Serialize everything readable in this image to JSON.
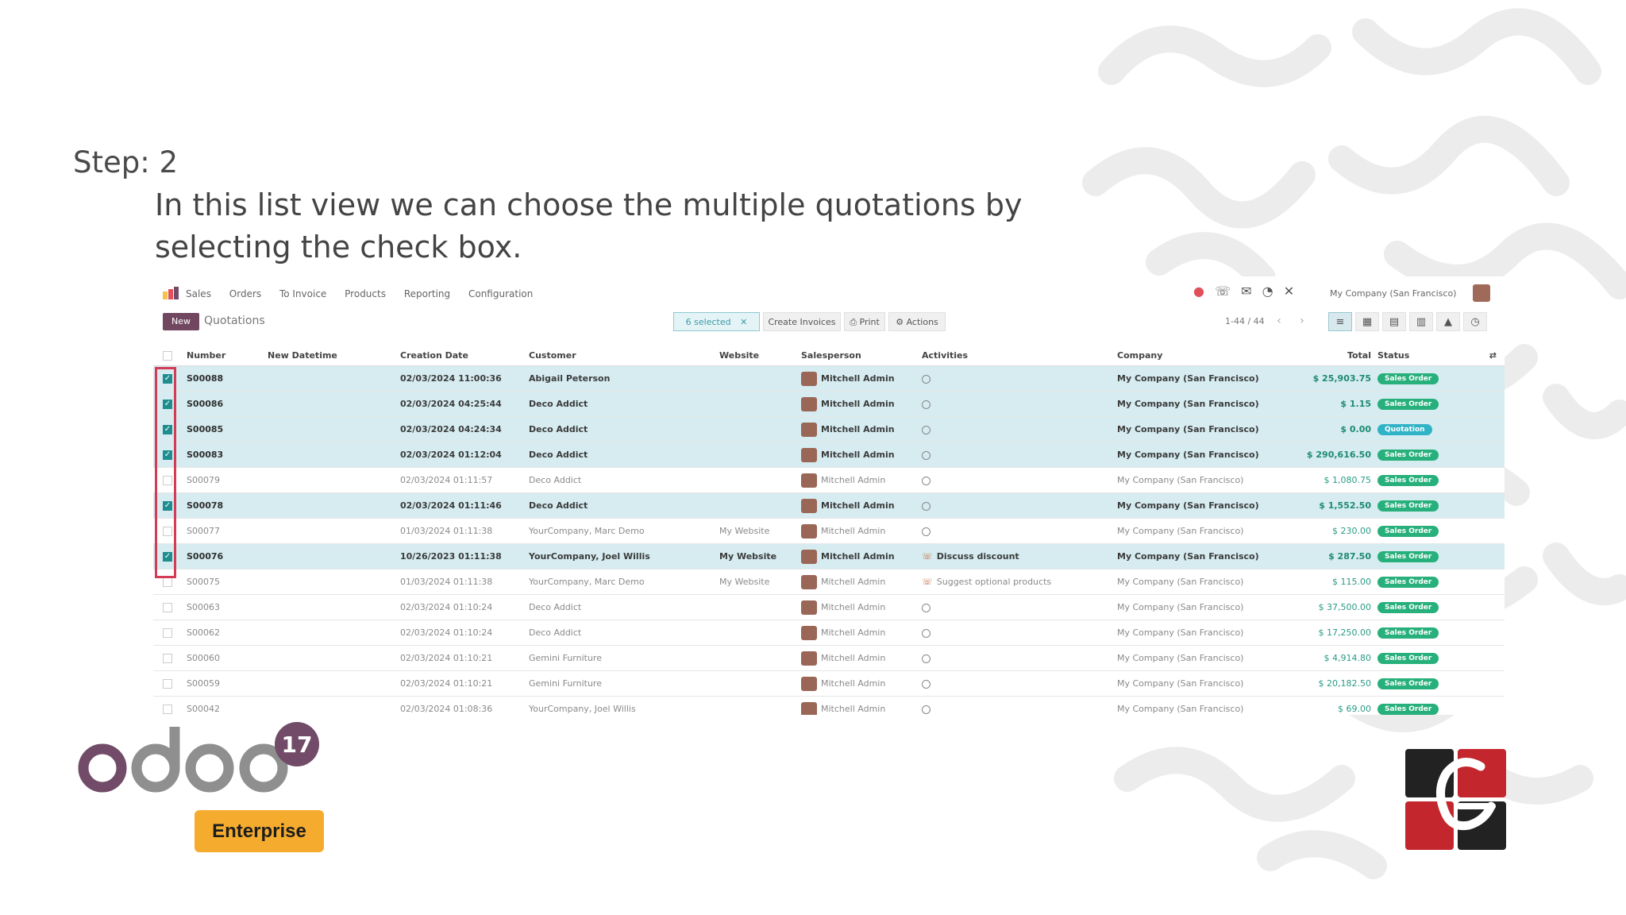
{
  "slide": {
    "step": "Step: 2",
    "description": "In this list view we can choose the multiple quotations by selecting the check box."
  },
  "topbar": {
    "app_name": "Sales",
    "menu": [
      "Orders",
      "To Invoice",
      "Products",
      "Reporting",
      "Configuration"
    ],
    "company": "My Company (San Francisco)"
  },
  "control": {
    "new_label": "New",
    "breadcrumb": "Quotations",
    "selected_label": "6 selected",
    "create_invoices": "Create Invoices",
    "print": "Print",
    "actions": "Actions",
    "pager": "1-44 / 44"
  },
  "columns": [
    "Number",
    "New Datetime",
    "Creation Date",
    "Customer",
    "Website",
    "Salesperson",
    "Activities",
    "Company",
    "Total",
    "Status"
  ],
  "rows": [
    {
      "selected": true,
      "number": "S00088",
      "date": "02/03/2024 11:00:36",
      "customer": "Abigail Peterson",
      "website": "",
      "salesperson": "Mitchell Admin",
      "activity": "",
      "company": "My Company (San Francisco)",
      "total": "$ 25,903.75",
      "status": "Sales Order"
    },
    {
      "selected": true,
      "number": "S00086",
      "date": "02/03/2024 04:25:44",
      "customer": "Deco Addict",
      "website": "",
      "salesperson": "Mitchell Admin",
      "activity": "",
      "company": "My Company (San Francisco)",
      "total": "$ 1.15",
      "status": "Sales Order"
    },
    {
      "selected": true,
      "number": "S00085",
      "date": "02/03/2024 04:24:34",
      "customer": "Deco Addict",
      "website": "",
      "salesperson": "Mitchell Admin",
      "activity": "",
      "company": "My Company (San Francisco)",
      "total": "$ 0.00",
      "status": "Quotation"
    },
    {
      "selected": true,
      "number": "S00083",
      "date": "02/03/2024 01:12:04",
      "customer": "Deco Addict",
      "website": "",
      "salesperson": "Mitchell Admin",
      "activity": "",
      "company": "My Company (San Francisco)",
      "total": "$ 290,616.50",
      "status": "Sales Order"
    },
    {
      "selected": false,
      "number": "S00079",
      "date": "02/03/2024 01:11:57",
      "customer": "Deco Addict",
      "website": "",
      "salesperson": "Mitchell Admin",
      "activity": "",
      "company": "My Company (San Francisco)",
      "total": "$ 1,080.75",
      "status": "Sales Order"
    },
    {
      "selected": true,
      "number": "S00078",
      "date": "02/03/2024 01:11:46",
      "customer": "Deco Addict",
      "website": "",
      "salesperson": "Mitchell Admin",
      "activity": "",
      "company": "My Company (San Francisco)",
      "total": "$ 1,552.50",
      "status": "Sales Order"
    },
    {
      "selected": false,
      "number": "S00077",
      "date": "01/03/2024 01:11:38",
      "customer": "YourCompany, Marc Demo",
      "website": "My Website",
      "salesperson": "Mitchell Admin",
      "activity": "",
      "company": "My Company (San Francisco)",
      "total": "$ 230.00",
      "status": "Sales Order"
    },
    {
      "selected": true,
      "number": "S00076",
      "date": "10/26/2023 01:11:38",
      "customer": "YourCompany, Joel Willis",
      "website": "My Website",
      "salesperson": "Mitchell Admin",
      "activity": "Discuss discount",
      "company": "My Company (San Francisco)",
      "total": "$ 287.50",
      "status": "Sales Order"
    },
    {
      "selected": false,
      "number": "S00075",
      "date": "01/03/2024 01:11:38",
      "customer": "YourCompany, Marc Demo",
      "website": "My Website",
      "salesperson": "Mitchell Admin",
      "activity": "Suggest optional products",
      "company": "My Company (San Francisco)",
      "total": "$ 115.00",
      "status": "Sales Order"
    },
    {
      "selected": false,
      "number": "S00063",
      "date": "02/03/2024 01:10:24",
      "customer": "Deco Addict",
      "website": "",
      "salesperson": "Mitchell Admin",
      "activity": "",
      "company": "My Company (San Francisco)",
      "total": "$ 37,500.00",
      "status": "Sales Order"
    },
    {
      "selected": false,
      "number": "S00062",
      "date": "02/03/2024 01:10:24",
      "customer": "Deco Addict",
      "website": "",
      "salesperson": "Mitchell Admin",
      "activity": "",
      "company": "My Company (San Francisco)",
      "total": "$ 17,250.00",
      "status": "Sales Order"
    },
    {
      "selected": false,
      "number": "S00060",
      "date": "02/03/2024 01:10:21",
      "customer": "Gemini Furniture",
      "website": "",
      "salesperson": "Mitchell Admin",
      "activity": "",
      "company": "My Company (San Francisco)",
      "total": "$ 4,914.80",
      "status": "Sales Order"
    },
    {
      "selected": false,
      "number": "S00059",
      "date": "02/03/2024 01:10:21",
      "customer": "Gemini Furniture",
      "website": "",
      "salesperson": "Mitchell Admin",
      "activity": "",
      "company": "My Company (San Francisco)",
      "total": "$ 20,182.50",
      "status": "Sales Order"
    },
    {
      "selected": false,
      "number": "S00042",
      "date": "02/03/2024 01:08:36",
      "customer": "YourCompany, Joel Willis",
      "website": "",
      "salesperson": "Mitchell Admin",
      "activity": "",
      "company": "My Company (San Francisco)",
      "total": "$ 69.00",
      "status": "Sales Order"
    }
  ],
  "logo": {
    "wordmark": "odoo",
    "version": "17",
    "edition": "Enterprise"
  },
  "colors": {
    "selected_row": "#d6ecf1",
    "highlight_box": "#d43c55",
    "odoo_purple": "#714b67",
    "enterprise_badge": "#f5ac2e",
    "status_green": "#27b07b"
  }
}
